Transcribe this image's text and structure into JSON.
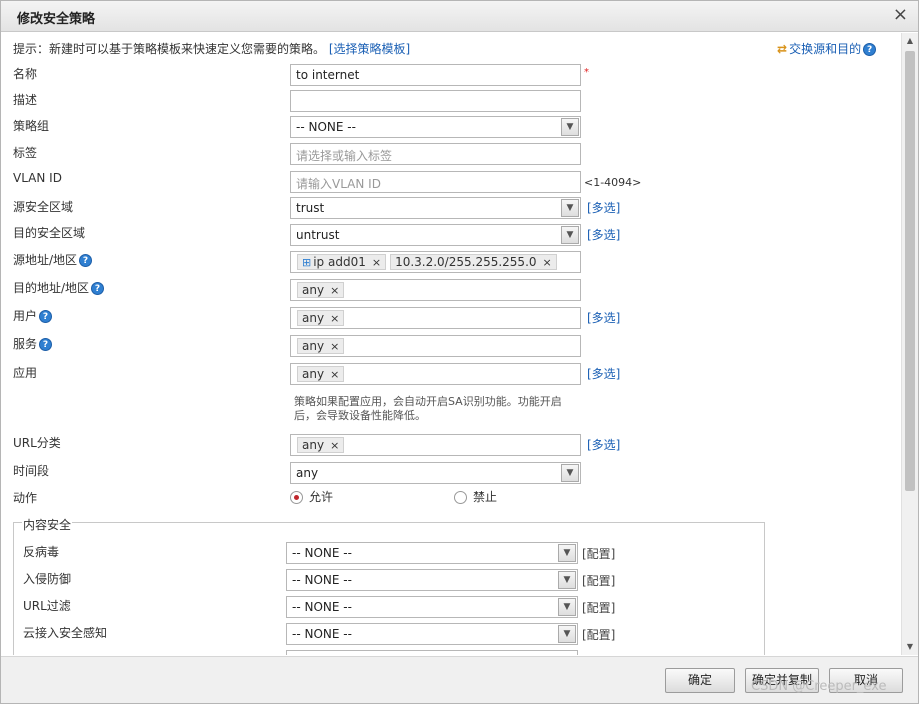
{
  "dialog": {
    "title": "修改安全策略",
    "close": "×"
  },
  "hint": {
    "text": "提示：新建时可以基于策略模板来快速定义您需要的策略。",
    "template_link": "[选择策略模板]"
  },
  "swap": {
    "label": "交换源和目的"
  },
  "help_glyph": "?",
  "form": {
    "name": {
      "label": "名称",
      "value": "to internet",
      "required": "*"
    },
    "desc": {
      "label": "描述",
      "value": ""
    },
    "group": {
      "label": "策略组",
      "value": "-- NONE --"
    },
    "tag": {
      "label": "标签",
      "placeholder": "请选择或输入标签"
    },
    "vlan": {
      "label": "VLAN ID",
      "placeholder": "请输入VLAN ID",
      "range": "<1-4094>"
    },
    "src_zone": {
      "label": "源安全区域",
      "value": "trust",
      "multi": "[多选]"
    },
    "dst_zone": {
      "label": "目的安全区域",
      "value": "untrust",
      "multi": "[多选]"
    },
    "src_addr": {
      "label": "源地址/地区",
      "tags": [
        "ip add01",
        "10.3.2.0/255.255.255.0"
      ]
    },
    "dst_addr": {
      "label": "目的地址/地区",
      "tags": [
        "any"
      ]
    },
    "user": {
      "label": "用户",
      "tags": [
        "any"
      ],
      "multi": "[多选]"
    },
    "service": {
      "label": "服务",
      "tags": [
        "any"
      ]
    },
    "app": {
      "label": "应用",
      "tags": [
        "any"
      ],
      "multi": "[多选]",
      "note_line1": "策略如果配置应用，会自动开启SA识别功能。功能开启",
      "note_line2": "后，会导致设备性能降低。"
    },
    "url_cat": {
      "label": "URL分类",
      "tags": [
        "any"
      ],
      "multi": "[多选]"
    },
    "time": {
      "label": "时间段",
      "value": "any"
    },
    "action": {
      "label": "动作",
      "permit": "允许",
      "deny": "禁止",
      "selected": "允许"
    }
  },
  "tag_remove": "×",
  "content_security": {
    "legend": "内容安全",
    "config": "[配置]",
    "rows": [
      {
        "label": "反病毒",
        "value": "-- NONE --"
      },
      {
        "label": "入侵防御",
        "value": "-- NONE --"
      },
      {
        "label": "URL过滤",
        "value": "-- NONE --"
      },
      {
        "label": "云接入安全感知",
        "value": "-- NONE --"
      }
    ]
  },
  "buttons": {
    "ok": "确定",
    "ok_copy": "确定并复制",
    "cancel": "取消"
  },
  "watermark": "CSDN @Creeper_exe"
}
